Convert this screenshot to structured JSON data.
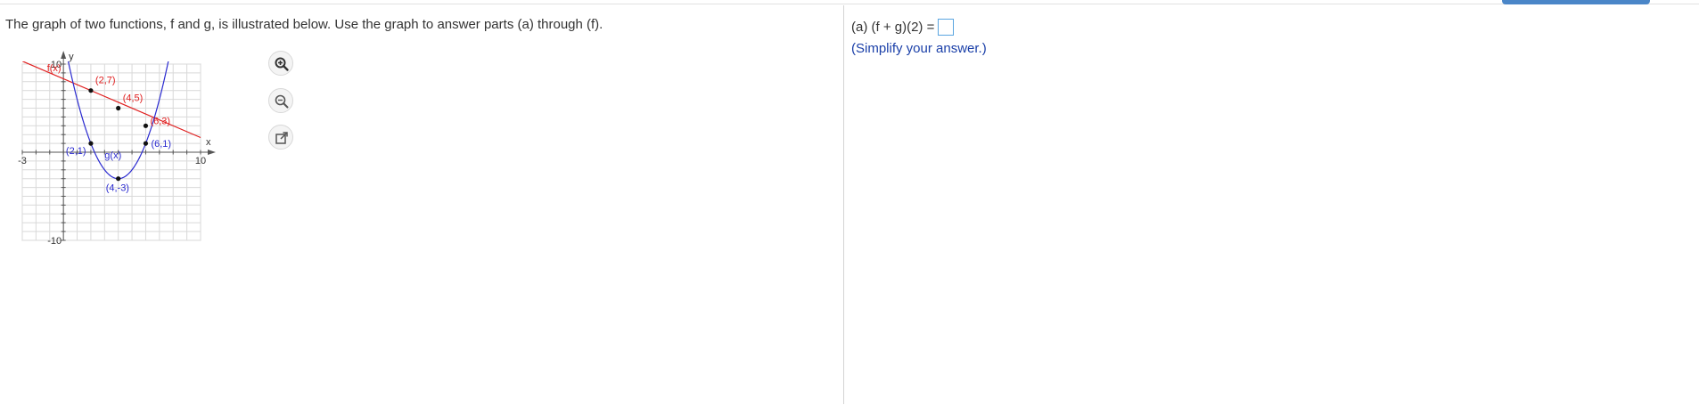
{
  "question": "The graph of two functions, f and g, is illustrated below. Use the graph to answer parts (a) through (f).",
  "answer": {
    "prompt": "(a) (f + g)(2) =",
    "value": "",
    "hint": "(Simplify your answer.)"
  },
  "tools": {
    "zoom_in": "zoom-in-icon",
    "zoom_out": "zoom-out-icon",
    "popout": "popout-icon"
  },
  "colors": {
    "f_line": "#e02020",
    "g_curve": "#2a2ad0",
    "answer_border": "#5aa5e0",
    "hint_text": "#1a3fa8"
  },
  "chart_data": {
    "type": "line",
    "xlim": [
      -3,
      10
    ],
    "ylim": [
      -10,
      10
    ],
    "grid": true,
    "x_axis_label": "x",
    "y_axis_label": "y",
    "x_tick_labels": [
      {
        "x": -3,
        "text": "-3"
      },
      {
        "x": 10,
        "text": "10"
      }
    ],
    "y_tick_labels": [
      {
        "y": 10,
        "text": "10"
      },
      {
        "y": -10,
        "text": "-10"
      }
    ],
    "series": [
      {
        "name": "f(x)",
        "kind": "line",
        "color": "#e02020",
        "x": [
          -1,
          2,
          4,
          6,
          10
        ],
        "y": [
          9,
          7,
          5,
          3,
          -1
        ]
      },
      {
        "name": "g(x)",
        "kind": "parabola",
        "color": "#2a2ad0",
        "vertex": [
          4,
          -3
        ],
        "a": 1
      }
    ],
    "points": [
      {
        "x": 2,
        "y": 7,
        "label": "(2,7)",
        "color": "#e02020"
      },
      {
        "x": 4,
        "y": 5,
        "label": "(4,5)",
        "color": "#e02020"
      },
      {
        "x": 6,
        "y": 3,
        "label": "(6,3)",
        "color": "#e02020"
      },
      {
        "x": 2,
        "y": 1,
        "label": "(2,1)",
        "color": "#2a2ad0"
      },
      {
        "x": 6,
        "y": 1,
        "label": "(6,1)",
        "color": "#2a2ad0"
      },
      {
        "x": 4,
        "y": -3,
        "label": "(4,-3)",
        "color": "#2a2ad0"
      }
    ],
    "annotations": [
      {
        "text": "f(x)",
        "x": -1.2,
        "y": 9.2,
        "color": "#e02020"
      },
      {
        "text": "g(x)",
        "x": 3.0,
        "y": -0.7,
        "color": "#2a2ad0"
      }
    ]
  }
}
